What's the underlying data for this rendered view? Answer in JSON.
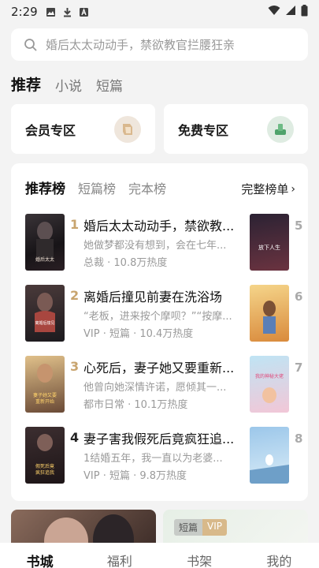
{
  "status": {
    "time": "2:29"
  },
  "search": {
    "placeholder": "婚后太太动动手，禁欲教官拦腰狂亲"
  },
  "tabs": [
    "推荐",
    "小说",
    "短篇"
  ],
  "zones": [
    "会员专区",
    "免费专区"
  ],
  "ranking": {
    "tabs": [
      "推荐榜",
      "短篇榜",
      "完本榜"
    ],
    "more": "完整榜单",
    "books": [
      {
        "num": "1",
        "title": "婚后太太动动手，禁欲教...",
        "desc": "她做梦都没有想到，会在七年...",
        "meta": "总裁 · 10.8万热度",
        "cover_text": "婚后太太动动手"
      },
      {
        "num": "2",
        "title": "离婚后撞见前妻在洗浴场",
        "desc": "“老板，进来按个摩呗？”“按摩...",
        "meta": "VIP · 短篇 · 10.4万热度",
        "cover_text": "离婚后撞见前妻在洗浴场"
      },
      {
        "num": "3",
        "title": "心死后，妻子她又要重新...",
        "desc": "他曾向她深情许诺，愿倾其一...",
        "meta": "都市日常 · 10.1万热度",
        "cover_text": "妻子她又要重新开始"
      },
      {
        "num": "4",
        "title": "妻子害我假死后竟疯狂追...",
        "desc": "1结婚五年，我一直以为老婆...",
        "meta": "VIP · 短篇 · 9.8万热度",
        "cover_text": "假死后竟疯狂追我"
      }
    ],
    "side_nums": [
      "5",
      "6",
      "7",
      "8"
    ],
    "side_covers": [
      "放下人生",
      "",
      "我的神秘大佬",
      ""
    ]
  },
  "banner": {
    "tag_a": "短篇",
    "tag_b": "VIP"
  },
  "nav": [
    "书城",
    "福利",
    "书架",
    "我的"
  ],
  "colors": {
    "accent_gold": "#c8a46e",
    "bg": "#f3f3f3"
  }
}
